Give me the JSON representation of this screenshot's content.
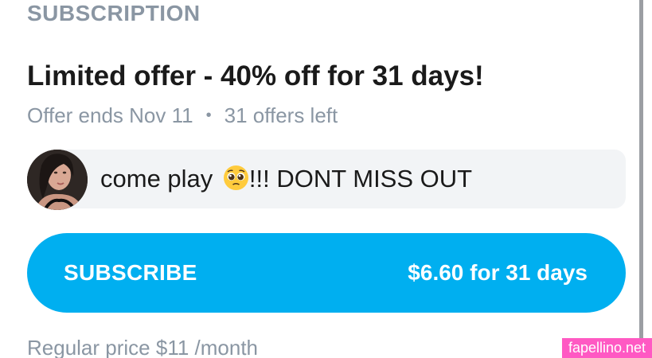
{
  "section": {
    "heading": "SUBSCRIPTION"
  },
  "offer": {
    "title": "Limited offer - 40% off for 31 days!",
    "ends": "Offer ends Nov 11",
    "separator": "•",
    "remaining": "31 offers left"
  },
  "message": {
    "text_before_emoji": "come play",
    "emoji_icon": "pleading-face-emoji",
    "text_after_emoji": "!!! DONT MISS OUT"
  },
  "subscribe": {
    "label": "SUBSCRIBE",
    "price": "$6.60 for 31 days"
  },
  "pricing": {
    "regular": "Regular price $11 /month"
  },
  "watermark": {
    "text": "fapellino.net"
  },
  "colors": {
    "accent": "#00aff0",
    "muted_text": "#8a96a3",
    "primary_text": "#1a1a1a",
    "watermark": "#ff59c3"
  }
}
